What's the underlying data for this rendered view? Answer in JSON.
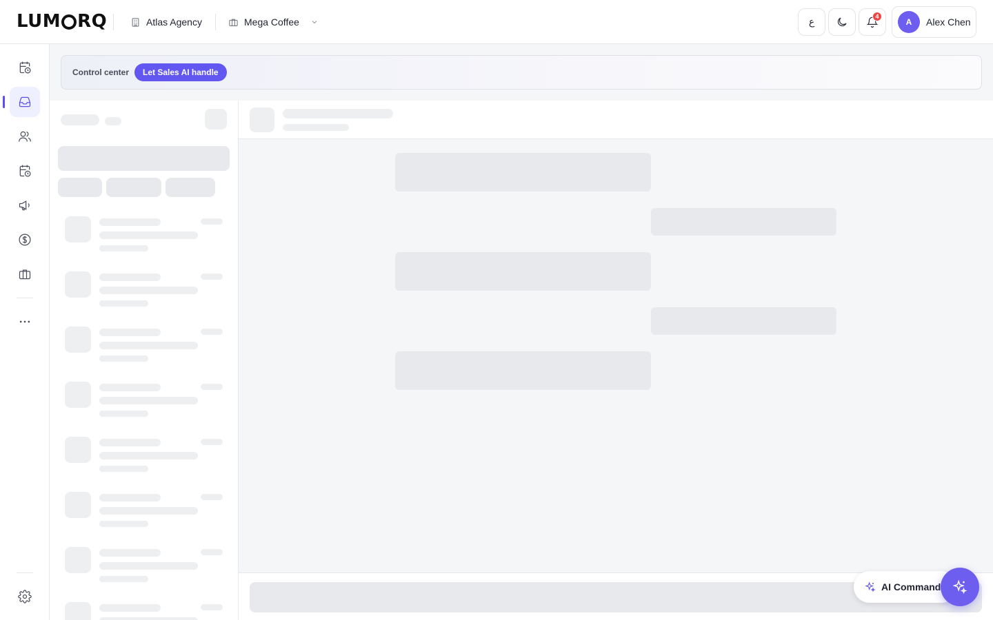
{
  "header": {
    "logo_text": "LUMORQ",
    "agency": "Atlas Agency",
    "workspace": "Mega Coffee",
    "language_toggle": "ع",
    "notification_count": "4",
    "user_initial": "A",
    "user_name": "Alex Chen"
  },
  "sidebar": {
    "items": [
      {
        "name": "calendar-clock",
        "icon": "calendar-clock-icon"
      },
      {
        "name": "inbox",
        "icon": "inbox-icon",
        "active": true
      },
      {
        "name": "contacts",
        "icon": "users-icon"
      },
      {
        "name": "schedule",
        "icon": "calendar-clock-icon"
      },
      {
        "name": "campaigns",
        "icon": "megaphone-icon"
      },
      {
        "name": "sales",
        "icon": "dollar-icon"
      },
      {
        "name": "business",
        "icon": "briefcase-icon"
      },
      {
        "name": "more",
        "icon": "more-icon"
      }
    ],
    "settings_icon": "gear-icon"
  },
  "banner": {
    "label": "Control center",
    "button": "Let Sales AI handle"
  },
  "ai_command": {
    "label": "AI Command"
  },
  "colors": {
    "accent": "#6357f2",
    "badge": "#ef4444"
  }
}
